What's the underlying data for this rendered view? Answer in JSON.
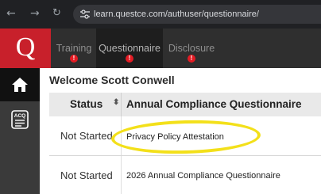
{
  "browser": {
    "url": "learn.questce.com/authuser/questionnaire/",
    "back_icon": "arrow-left-icon",
    "forward_icon": "arrow-right-icon",
    "reload_icon": "reload-icon",
    "site_info_icon": "tune-icon"
  },
  "header": {
    "logo_letter": "Q",
    "brand_color": "#c8202b",
    "tabs": [
      {
        "label": "Training",
        "alert": "!",
        "active": false
      },
      {
        "label": "Questionnaire",
        "alert": "!",
        "active": true
      },
      {
        "label": "Disclosure",
        "alert": "!",
        "active": false
      }
    ]
  },
  "sidebar": {
    "items": [
      {
        "icon": "home-icon",
        "active": true
      },
      {
        "icon": "acq-icon",
        "text": "ACQ",
        "active": false
      }
    ]
  },
  "main": {
    "welcome": "Welcome Scott Conwell",
    "table": {
      "columns": [
        "Status",
        "Annual Compliance Questionnaire"
      ],
      "sort_glyph": "⬍",
      "rows": [
        {
          "status": "Not Started",
          "name": "Privacy Policy Attestation"
        },
        {
          "status": "Not Started",
          "name": "2026 Annual Compliance Questionnaire"
        }
      ]
    },
    "highlight_color": "#f3e01a"
  }
}
